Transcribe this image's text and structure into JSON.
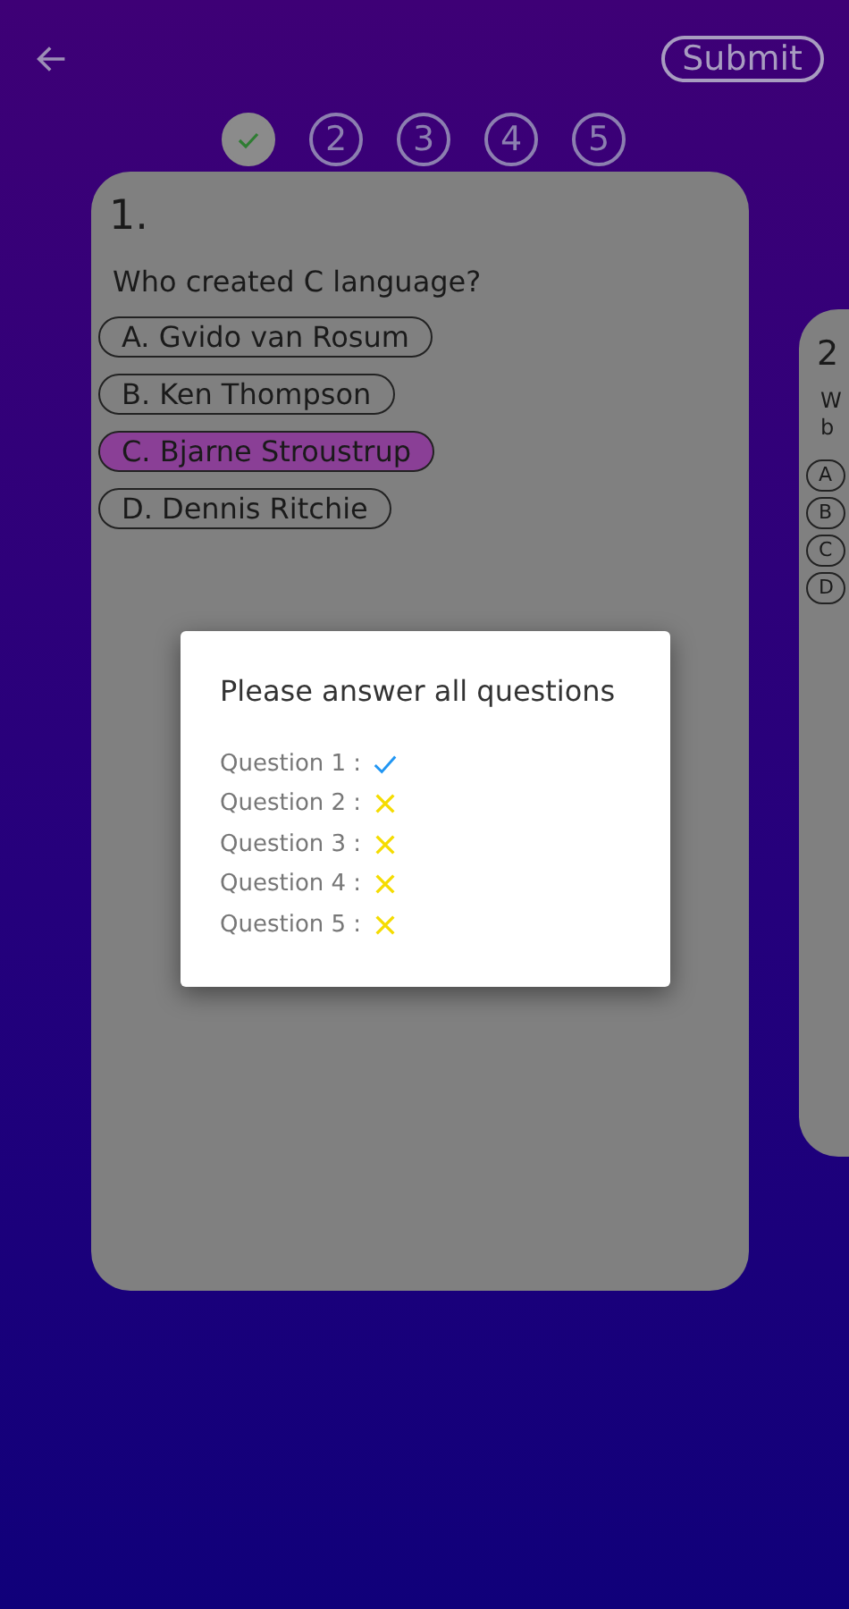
{
  "header": {
    "submit": "Submit"
  },
  "steps": [
    {
      "done": true
    },
    {
      "label": "2",
      "done": false
    },
    {
      "label": "3",
      "done": false
    },
    {
      "label": "4",
      "done": false
    },
    {
      "label": "5",
      "done": false
    }
  ],
  "cards": [
    {
      "number": "1.",
      "question": [
        "Who created C language?"
      ],
      "options": [
        {
          "label": "A. Gvido van Rosum",
          "selected": false
        },
        {
          "label": "B. Ken Thompson",
          "selected": false
        },
        {
          "label": "C. Bjarne Stroustrup",
          "selected": true
        },
        {
          "label": "D. Dennis Ritchie",
          "selected": false
        }
      ]
    },
    {
      "number": "2",
      "question": [
        "W",
        "b"
      ],
      "options": [
        {
          "label": "A",
          "selected": false
        },
        {
          "label": "B",
          "selected": false
        },
        {
          "label": "C",
          "selected": false
        },
        {
          "label": "D",
          "selected": false
        }
      ]
    }
  ],
  "dialog": {
    "title": "Please answer all questions",
    "items": [
      {
        "label": "Question 1 :",
        "answered": true
      },
      {
        "label": "Question 2 :",
        "answered": false
      },
      {
        "label": "Question 3 :",
        "answered": false
      },
      {
        "label": "Question 4 :",
        "answered": false
      },
      {
        "label": "Question 5 :",
        "answered": false
      }
    ]
  }
}
